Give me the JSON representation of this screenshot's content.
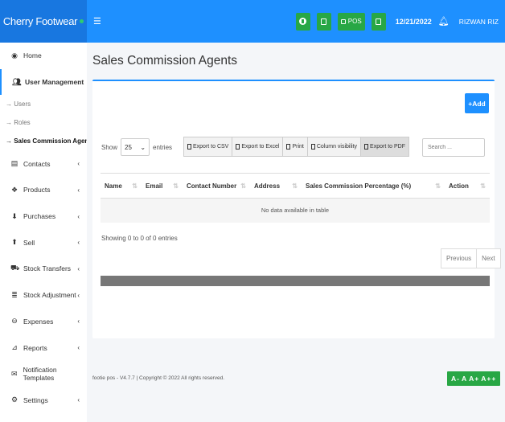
{
  "brand": {
    "name": "Cherry Footwear"
  },
  "header": {
    "date": "12/21/2022",
    "user": "RIZWAN RIZ",
    "pos_label": "POS"
  },
  "sidebar": {
    "items": [
      {
        "label": "Home",
        "icon": "dashboard-icon"
      },
      {
        "label": "User Management",
        "icon": "users-icon"
      },
      {
        "label": "Contacts",
        "icon": "address-book-icon"
      },
      {
        "label": "Products",
        "icon": "cubes-icon"
      },
      {
        "label": "Purchases",
        "icon": "arrow-circle-down-icon"
      },
      {
        "label": "Sell",
        "icon": "arrow-circle-up-icon"
      },
      {
        "label": "Stock Transfers",
        "icon": "truck-icon"
      },
      {
        "label": "Stock Adjustment",
        "icon": "database-icon"
      },
      {
        "label": "Expenses",
        "icon": "minus-circle-icon"
      },
      {
        "label": "Reports",
        "icon": "chart-icon"
      },
      {
        "label": "Notification Templates",
        "icon": "envelope-icon"
      },
      {
        "label": "Settings",
        "icon": "cog-icon"
      }
    ],
    "subitems": [
      {
        "label": "→ Users"
      },
      {
        "label": "→ Roles"
      },
      {
        "label": "→ Sales Commission Agents"
      }
    ]
  },
  "page": {
    "title": "Sales Commission Agents",
    "add_label": "+Add",
    "show_label": "Show",
    "entries_value": "25",
    "entries_label": "entries",
    "search_placeholder": "Search ...",
    "export_buttons": [
      "Export to CSV",
      "Export to Excel",
      "Print",
      "Column visibility",
      "Export to PDF"
    ],
    "table": {
      "headers": [
        "Name",
        "Email",
        "Contact Number",
        "Address",
        "Sales Commission Percentage (%)",
        "Action"
      ],
      "empty_text": "No data available in table"
    },
    "info": "Showing 0 to 0 of 0 entries",
    "pager": {
      "previous": "Previous",
      "next": "Next"
    }
  },
  "footer": {
    "text": "footie pos - V4.7.7 | Copyright © 2022 All rights reserved.",
    "font_buttons": [
      "A-",
      "A",
      "A+",
      "A++"
    ]
  },
  "colors": {
    "accent": "#1e90ff",
    "brand_bg": "#1877e0",
    "success": "#28a745"
  }
}
